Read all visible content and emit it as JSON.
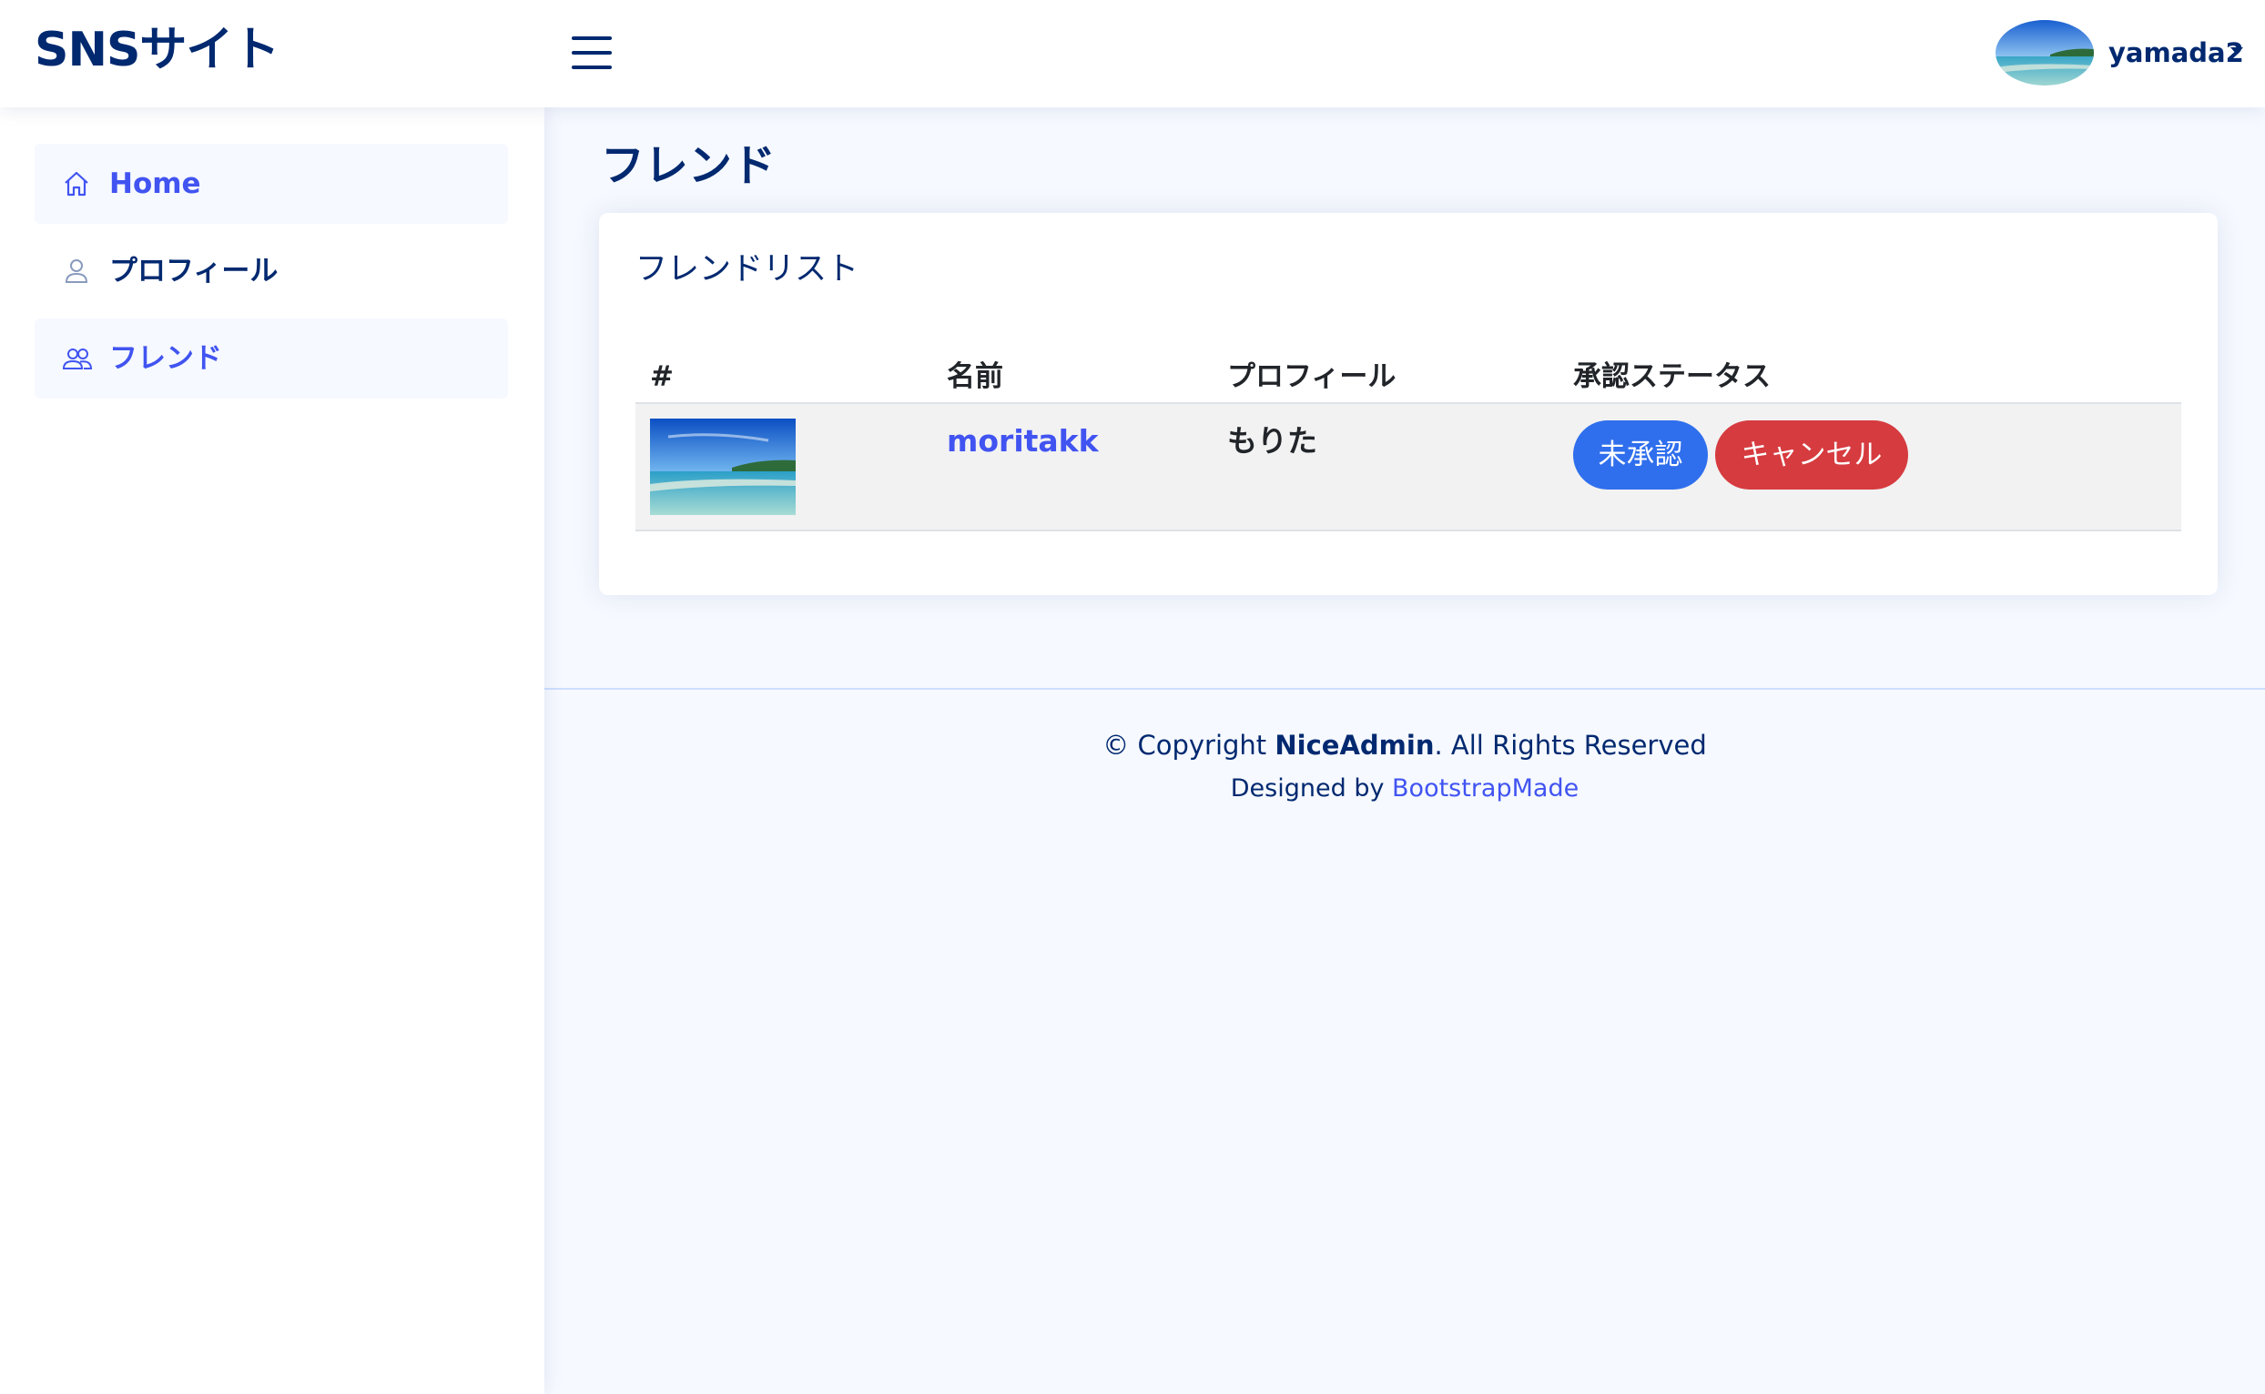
{
  "header": {
    "logo": "SNSサイト",
    "user_name": "yamada2"
  },
  "sidebar": {
    "items": [
      {
        "label": "Home",
        "icon": "house-icon",
        "active": true
      },
      {
        "label": "プロフィール",
        "icon": "person-icon",
        "active": false
      },
      {
        "label": "フレンド",
        "icon": "people-icon",
        "active": true
      }
    ]
  },
  "main": {
    "page_title": "フレンド",
    "card_title": "フレンドリスト",
    "table": {
      "headers": [
        "#",
        "名前",
        "プロフィール",
        "承認ステータス"
      ],
      "rows": [
        {
          "name": "moritakk",
          "profile": "もりた",
          "status_label": "未承認",
          "cancel_label": "キャンセル"
        }
      ]
    }
  },
  "footer": {
    "copyright_prefix": "© Copyright",
    "brand": "NiceAdmin",
    "copyright_suffix": ". All Rights Reserved",
    "designed_by": "Designed by",
    "designer_link": "BootstrapMade"
  },
  "colors": {
    "primary": "#4154f1",
    "navy": "#012970",
    "pending_button": "#2f6fed",
    "cancel_button": "#d63b3f"
  }
}
